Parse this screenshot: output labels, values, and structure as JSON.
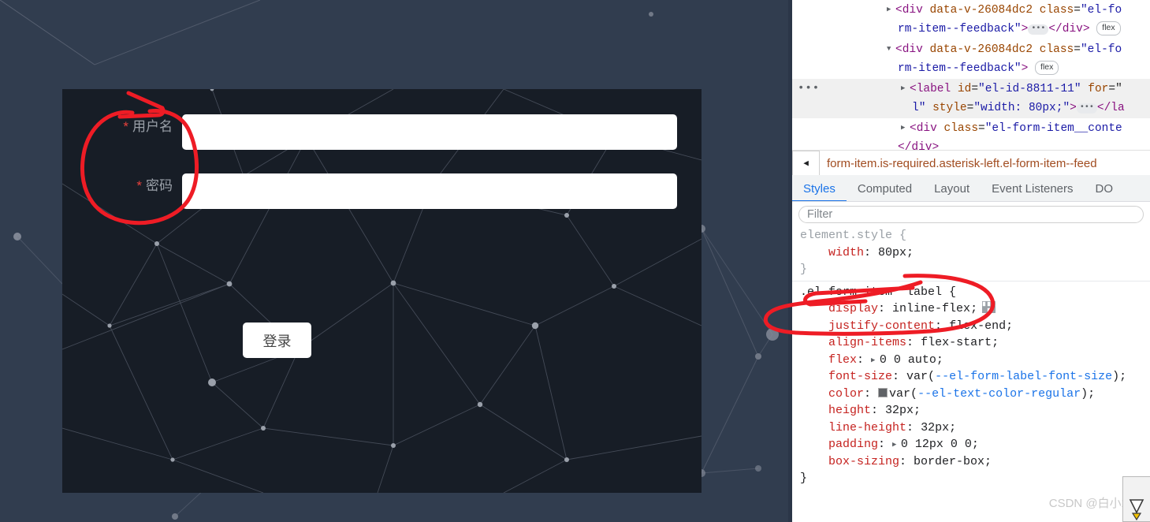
{
  "app": {
    "panel_bg": "#171d26",
    "page_bg": "#313d4f",
    "form": {
      "fields": [
        {
          "label": "用户名",
          "required_mark": "*",
          "value": "",
          "placeholder": ""
        },
        {
          "label": "密码",
          "required_mark": "*",
          "value": "",
          "placeholder": ""
        }
      ],
      "submit_label": "登录"
    }
  },
  "devtools": {
    "dom_lines": [
      {
        "indent": 120,
        "triangle": "closed",
        "selected": false,
        "parts": [
          {
            "t": "punct",
            "s": "<"
          },
          {
            "t": "tagname",
            "s": "div"
          },
          {
            "t": "plain",
            "s": " "
          },
          {
            "t": "attr",
            "s": "data-v-26084dc2"
          },
          {
            "t": "plain",
            "s": " "
          },
          {
            "t": "attr",
            "s": "class"
          },
          {
            "t": "plain",
            "s": "="
          },
          {
            "t": "val",
            "s": "\"el-fo"
          }
        ]
      },
      {
        "indent": 134,
        "triangle": "none",
        "selected": false,
        "parts": [
          {
            "t": "val",
            "s": "rm-item--feedback\""
          },
          {
            "t": "punct",
            "s": ">"
          },
          {
            "t": "ellipsis",
            "s": ""
          },
          {
            "t": "punct",
            "s": "</div>"
          },
          {
            "t": "flexbadge",
            "s": "flex"
          }
        ]
      },
      {
        "indent": 120,
        "triangle": "open",
        "selected": false,
        "parts": [
          {
            "t": "punct",
            "s": "<"
          },
          {
            "t": "tagname",
            "s": "div"
          },
          {
            "t": "plain",
            "s": " "
          },
          {
            "t": "attr",
            "s": "data-v-26084dc2"
          },
          {
            "t": "plain",
            "s": " "
          },
          {
            "t": "attr",
            "s": "class"
          },
          {
            "t": "plain",
            "s": "="
          },
          {
            "t": "val",
            "s": "\"el-fo"
          }
        ]
      },
      {
        "indent": 134,
        "triangle": "none",
        "selected": false,
        "parts": [
          {
            "t": "val",
            "s": "rm-item--feedback\""
          },
          {
            "t": "punct",
            "s": ">"
          },
          {
            "t": "flexbadge",
            "s": "flex"
          }
        ]
      },
      {
        "indent": 138,
        "triangle": "closed",
        "selected": true,
        "dots": "•••",
        "parts": [
          {
            "t": "punct",
            "s": "<"
          },
          {
            "t": "tagname",
            "s": "label"
          },
          {
            "t": "plain",
            "s": " "
          },
          {
            "t": "attr",
            "s": "id"
          },
          {
            "t": "plain",
            "s": "="
          },
          {
            "t": "val",
            "s": "\"el-id-8811-11\""
          },
          {
            "t": "plain",
            "s": " "
          },
          {
            "t": "attr",
            "s": "for"
          },
          {
            "t": "plain",
            "s": "=\""
          }
        ]
      },
      {
        "indent": 152,
        "triangle": "none",
        "selected": true,
        "parts": [
          {
            "t": "val",
            "s": "l\""
          },
          {
            "t": "plain",
            "s": " "
          },
          {
            "t": "attr",
            "s": "style"
          },
          {
            "t": "plain",
            "s": "="
          },
          {
            "t": "val",
            "s": "\"width: 80px;\""
          },
          {
            "t": "punct",
            "s": ">"
          },
          {
            "t": "ellipsis",
            "s": ""
          },
          {
            "t": "punct",
            "s": "</la"
          }
        ]
      },
      {
        "indent": 138,
        "triangle": "closed",
        "selected": false,
        "parts": [
          {
            "t": "punct",
            "s": "<"
          },
          {
            "t": "tagname",
            "s": "div"
          },
          {
            "t": "plain",
            "s": " "
          },
          {
            "t": "attr",
            "s": "class"
          },
          {
            "t": "plain",
            "s": "="
          },
          {
            "t": "val",
            "s": "\"el-form-item__conte"
          }
        ]
      },
      {
        "indent": 134,
        "triangle": "none",
        "selected": false,
        "clipped": true,
        "parts": [
          {
            "t": "punct",
            "s": "</div>"
          }
        ]
      }
    ],
    "breadcrumb": {
      "collapse_icon": "◀",
      "text": "form-item.is-required.asterisk-left.el-form-item--feed"
    },
    "tabs": [
      {
        "label": "Styles",
        "active": true
      },
      {
        "label": "Computed",
        "active": false
      },
      {
        "label": "Layout",
        "active": false
      },
      {
        "label": "Event Listeners",
        "active": false
      },
      {
        "label": "DO",
        "active": false
      }
    ],
    "filter": {
      "placeholder": "Filter",
      "value": ""
    },
    "style_rules": [
      {
        "selector": "element.style",
        "selector_muted": true,
        "declarations": [
          {
            "prop": "width",
            "value": "80px",
            "arrow": false,
            "swatch": null,
            "var": null,
            "flexicon": false
          }
        ]
      },
      {
        "selector": ".el-form-item  label",
        "selector_muted": false,
        "declarations": [
          {
            "prop": "display",
            "value": "inline-flex",
            "arrow": false,
            "swatch": null,
            "var": null,
            "flexicon": true
          },
          {
            "prop": "justify-content",
            "value": "flex-end",
            "arrow": false,
            "swatch": null,
            "var": null,
            "flexicon": false
          },
          {
            "prop": "align-items",
            "value": "flex-start",
            "arrow": false,
            "swatch": null,
            "var": null,
            "flexicon": false
          },
          {
            "prop": "flex",
            "value": "0 0 auto",
            "arrow": true,
            "swatch": null,
            "var": null,
            "flexicon": false
          },
          {
            "prop": "font-size",
            "value": "",
            "arrow": false,
            "swatch": null,
            "var": "--el-form-label-font-size",
            "flexicon": false
          },
          {
            "prop": "color",
            "value": "",
            "arrow": false,
            "swatch": "#606266",
            "var": "--el-text-color-regular",
            "flexicon": false
          },
          {
            "prop": "height",
            "value": "32px",
            "arrow": false,
            "swatch": null,
            "var": null,
            "flexicon": false
          },
          {
            "prop": "line-height",
            "value": "32px",
            "arrow": false,
            "swatch": null,
            "var": null,
            "flexicon": false
          },
          {
            "prop": "padding",
            "value": "0 12px 0 0",
            "arrow": true,
            "swatch": null,
            "var": null,
            "flexicon": false
          },
          {
            "prop": "box-sizing",
            "value": "border-box",
            "arrow": false,
            "swatch": null,
            "var": null,
            "flexicon": false
          }
        ]
      }
    ],
    "watermark": "CSDN @白小水i",
    "accent_color": "#1a73e8",
    "annotation_color": "#ee1c25"
  }
}
